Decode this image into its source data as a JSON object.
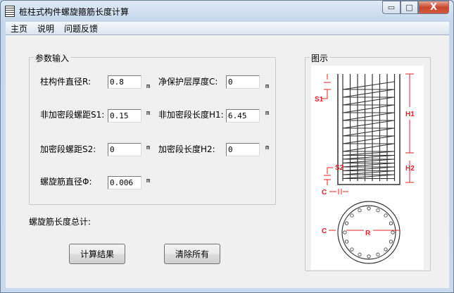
{
  "window": {
    "title": "桩柱式构件螺旋箍筋长度计算",
    "min": "▭",
    "max": "□",
    "close": "X"
  },
  "menu": [
    "主页",
    "说明",
    "问题反馈"
  ],
  "params": {
    "group_label": "参数输入",
    "fields": [
      {
        "label": "柱构件直径R:",
        "value": "0.8",
        "unit": "m"
      },
      {
        "label": "净保护层厚度C:",
        "value": "0",
        "unit": "m"
      },
      {
        "label": "非加密段螺距S1:",
        "value": "0.15",
        "unit": "m"
      },
      {
        "label": "非加密段长度H1:",
        "value": "6.45",
        "unit": "m"
      },
      {
        "label": "加密段螺距S2:",
        "value": "0",
        "unit": "m"
      },
      {
        "label": "加密段长度H2:",
        "value": "0",
        "unit": "m"
      },
      {
        "label": "螺旋筋直径Φ:",
        "value": "0.006",
        "unit": "m"
      }
    ]
  },
  "total_label": "螺旋筋长度总计:",
  "buttons": {
    "calc": "计算结果",
    "clear": "清除所有"
  },
  "diagram": {
    "group_label": "图示",
    "labels": {
      "s1": "S1",
      "s2": "S2",
      "h1": "H1",
      "h2": "H2",
      "c": "C",
      "r": "R"
    },
    "accent": "#e8202a"
  }
}
